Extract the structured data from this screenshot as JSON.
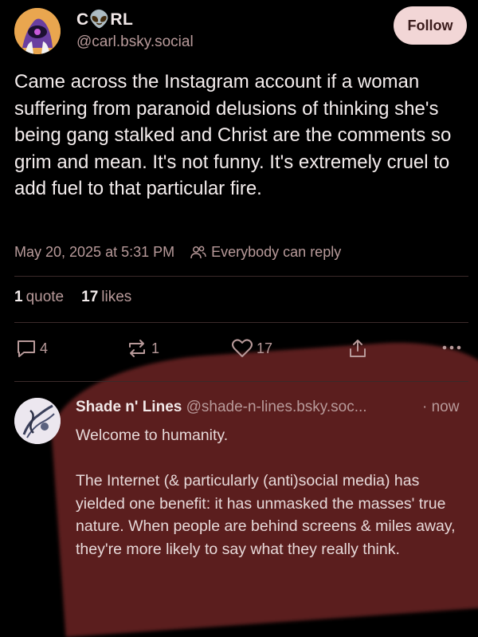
{
  "post": {
    "author_name": "C👽RL",
    "author_handle": "@carl.bsky.social",
    "follow_label": "Follow",
    "text": "Came across the Instagram account if a woman suffering from paranoid delusions of thinking she's being gang stalked and Christ are the comments so grim and mean. It's not funny. It's extremely cruel to add fuel to that particular fire.",
    "timestamp": "May 20, 2025 at 5:31 PM",
    "reply_setting": "Everybody can reply",
    "quotes_count": "1",
    "quotes_label": "quote",
    "likes_count": "17",
    "likes_label": "likes",
    "reply_count": "4",
    "repost_count": "1",
    "like_count": "17"
  },
  "reply": {
    "author_name": "Shade n' Lines",
    "author_handle": "@shade-n-lines.bsky.soc...",
    "time": "· now",
    "paragraph1": "Welcome to humanity.",
    "paragraph2": "The Internet (& particularly (anti)social media) has yielded one benefit: it has unmasked the masses' true nature. When people are behind screens & miles away, they're more likely to say what they really think."
  },
  "colors": {
    "background": "#000000",
    "accent_button": "#f2d6d6",
    "muted_text": "#b89a9a",
    "blob": "#5b1e1e"
  }
}
